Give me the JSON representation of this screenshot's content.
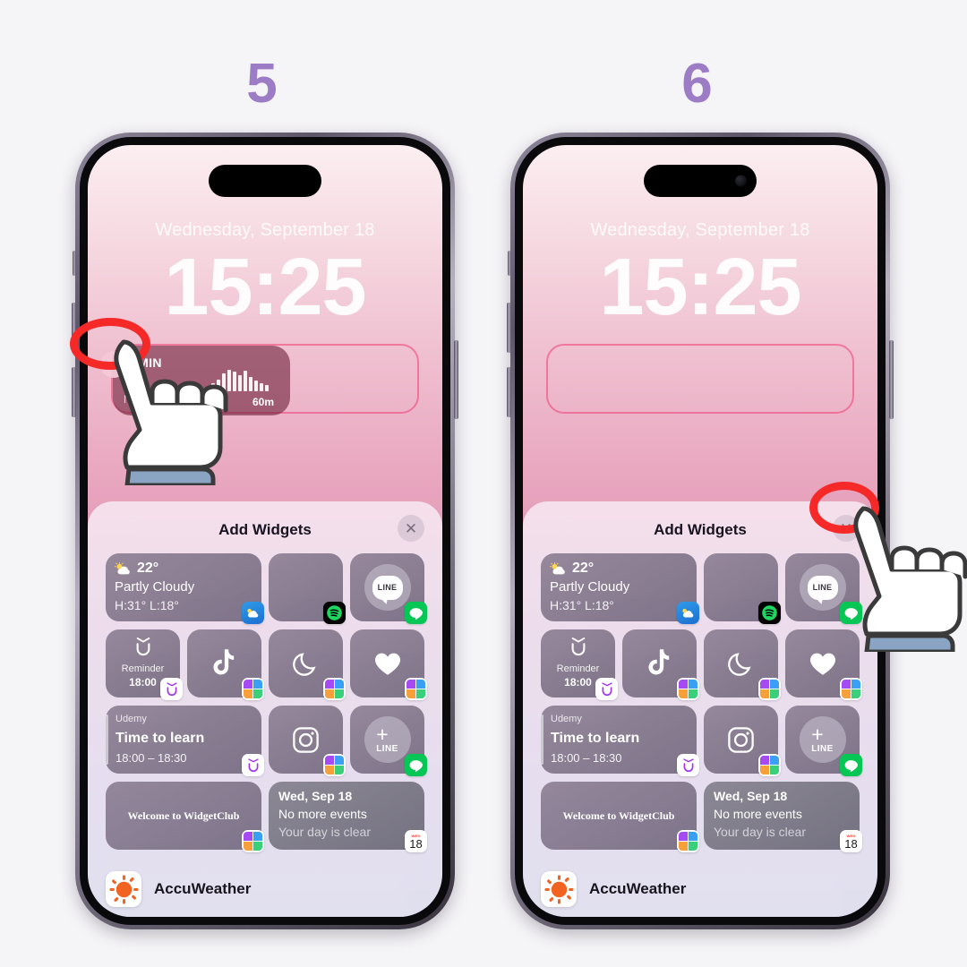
{
  "page": {
    "background_color": "#f5f4f7",
    "accent_number_color": "#9c7cc4",
    "highlight_ring_color": "#f62929"
  },
  "steps": [
    {
      "number": "5",
      "phone_key": "phone1"
    },
    {
      "number": "6",
      "phone_key": "phone2"
    }
  ],
  "lock_screen": {
    "date": "Wednesday, September 18",
    "time": "15:25",
    "widget_slot_phone1": {
      "state": "filled",
      "minus_button": "remove-widget",
      "widget": {
        "duration_label": "33MIN",
        "partial_prefix": "N",
        "bar_label": "60m",
        "bars": [
          9,
          13,
          20,
          24,
          22,
          18,
          23,
          16,
          12,
          9,
          7
        ]
      }
    },
    "widget_slot_phone2": {
      "state": "empty"
    }
  },
  "sheet": {
    "title": "Add Widgets",
    "close_icon": "close-icon",
    "widgets": [
      {
        "id": "weather",
        "size": "large",
        "temp": "22°",
        "condition": "Partly Cloudy",
        "high_low": "H:31° L:18°",
        "icon": "partly-cloudy-icon",
        "badge": "weather-app-badge"
      },
      {
        "id": "spotify",
        "size": "small",
        "icon": "blank-widget",
        "badge": "spotify-badge"
      },
      {
        "id": "line-message",
        "size": "small",
        "icon": "line-bubble-icon",
        "label": "LINE",
        "badge": "line-badge"
      },
      {
        "id": "reminder",
        "size": "small",
        "icon": "udemy-u-icon",
        "title": "Reminder",
        "time": "18:00",
        "badge": "udemy-badge"
      },
      {
        "id": "tiktok",
        "size": "small",
        "icon": "tiktok-icon",
        "badge": "widgetclub-badge"
      },
      {
        "id": "moon",
        "size": "small",
        "icon": "crescent-moon-icon",
        "badge": "widgetclub-badge"
      },
      {
        "id": "heart",
        "size": "small",
        "icon": "heart-icon",
        "badge": "widgetclub-badge"
      },
      {
        "id": "udemy-event",
        "size": "large",
        "source": "Udemy",
        "title": "Time to learn",
        "time_range": "18:00 – 18:30",
        "badge": "udemy-badge"
      },
      {
        "id": "instagram",
        "size": "small",
        "icon": "instagram-icon",
        "badge": "widgetclub-badge"
      },
      {
        "id": "line-add",
        "size": "small",
        "icon": "plus-icon",
        "label": "LINE",
        "badge": "line-badge"
      },
      {
        "id": "widgetclub-welcome",
        "size": "large",
        "text": "Welcome to WidgetClub",
        "badge": "widgetclub-badge"
      },
      {
        "id": "calendar",
        "size": "large",
        "line1": "Wed, Sep 18",
        "line2": "No more events",
        "line3": "Your day is clear",
        "badge": "calendar-badge",
        "badge_weekday": "WED",
        "badge_day": "18"
      }
    ],
    "footer": {
      "app_name": "AccuWeather",
      "app_icon": "accuweather-sun-icon"
    }
  }
}
